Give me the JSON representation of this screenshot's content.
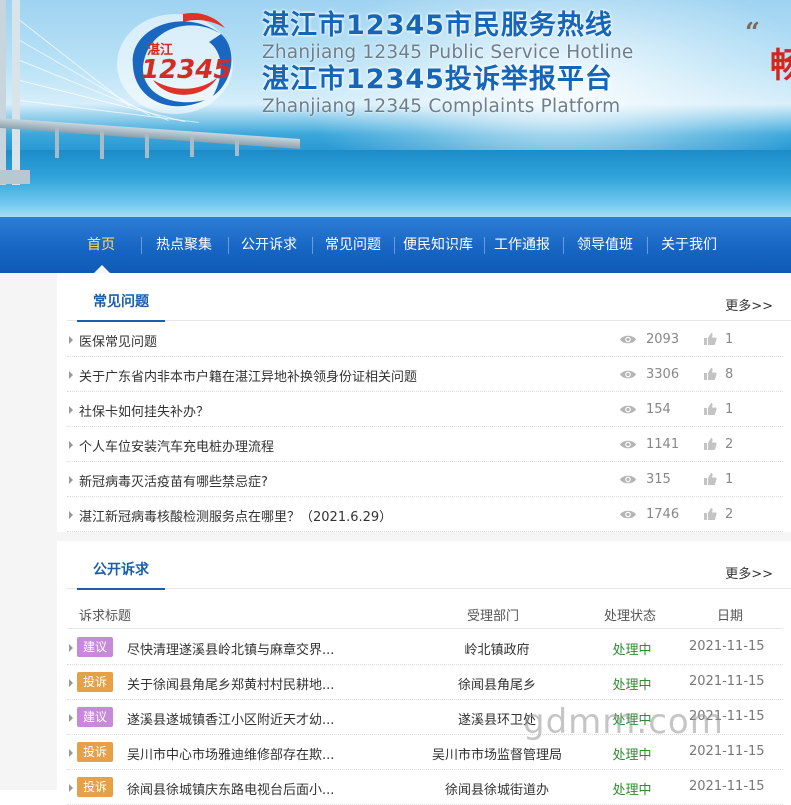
{
  "header": {
    "logo_text_cn": "湛江",
    "logo_number": "12345",
    "title_cn_1": "湛江市12345市民服务热线",
    "title_en_1": "Zhanjiang 12345 Public Service Hotline",
    "title_cn_2": "湛江市12345投诉举报平台",
    "title_en_2": "Zhanjiang 12345 Complaints Platform",
    "quote_glyph": "“",
    "side_char": "畅"
  },
  "nav": {
    "items": [
      {
        "label": "首页",
        "active": true
      },
      {
        "label": "热点聚集",
        "active": false
      },
      {
        "label": "公开诉求",
        "active": false
      },
      {
        "label": "常见问题",
        "active": false
      },
      {
        "label": "便民知识库",
        "active": false
      },
      {
        "label": "工作通报",
        "active": false
      },
      {
        "label": "领导值班",
        "active": false
      },
      {
        "label": "关于我们",
        "active": false
      }
    ]
  },
  "faq": {
    "title": "常见问题",
    "more": "更多>>",
    "items": [
      {
        "title": "医保常见问题",
        "views": "2093",
        "likes": "1"
      },
      {
        "title": "关于广东省内非本市户籍在湛江异地补换领身份证相关问题",
        "views": "3306",
        "likes": "8"
      },
      {
        "title": "社保卡如何挂失补办？",
        "views": "154",
        "likes": "1"
      },
      {
        "title": "个人车位安装汽车充电桩办理流程",
        "views": "1141",
        "likes": "2"
      },
      {
        "title": "新冠病毒灭活疫苗有哪些禁忌症?",
        "views": "315",
        "likes": "1"
      },
      {
        "title": "湛江新冠病毒核酸检测服务点在哪里？（2021.6.29）",
        "views": "1746",
        "likes": "2"
      }
    ]
  },
  "public": {
    "title": "公开诉求",
    "more": "更多>>",
    "columns": {
      "title": "诉求标题",
      "dept": "受理部门",
      "status": "处理状态",
      "date": "日期"
    },
    "rows": [
      {
        "type": "建议",
        "type_color": "#c78ad8",
        "title": "尽快清理遂溪县岭北镇与麻章交界...",
        "dept": "岭北镇政府",
        "status": "处理中",
        "date": "2021-11-15"
      },
      {
        "type": "投诉",
        "type_color": "#e6a048",
        "title": "关于徐闻县角尾乡郑黄村村民耕地...",
        "dept": "徐闻县角尾乡",
        "status": "处理中",
        "date": "2021-11-15"
      },
      {
        "type": "建议",
        "type_color": "#c78ad8",
        "title": "遂溪县遂城镇香江小区附近天才幼...",
        "dept": "遂溪县环卫处",
        "status": "处理中",
        "date": "2021-11-15"
      },
      {
        "type": "投诉",
        "type_color": "#e6a048",
        "title": "吴川市中心市场雅迪维修部存在欺...",
        "dept": "吴川市市场监督管理局",
        "status": "处理中",
        "date": "2021-11-15"
      },
      {
        "type": "投诉",
        "type_color": "#e6a048",
        "title": "徐闻县徐城镇庆东路电视台后面小...",
        "dept": "徐闻县徐城街道办",
        "status": "处理中",
        "date": "2021-11-15"
      }
    ]
  },
  "watermark": "gdmm.com",
  "colors": {
    "brand_blue": "#1565b8",
    "nav_active": "#ffe34a",
    "status_green": "#2e8b2e"
  },
  "icons": {
    "views": "eye-icon",
    "likes": "thumbs-up-icon",
    "bullet": "triangle-bullet-icon"
  }
}
